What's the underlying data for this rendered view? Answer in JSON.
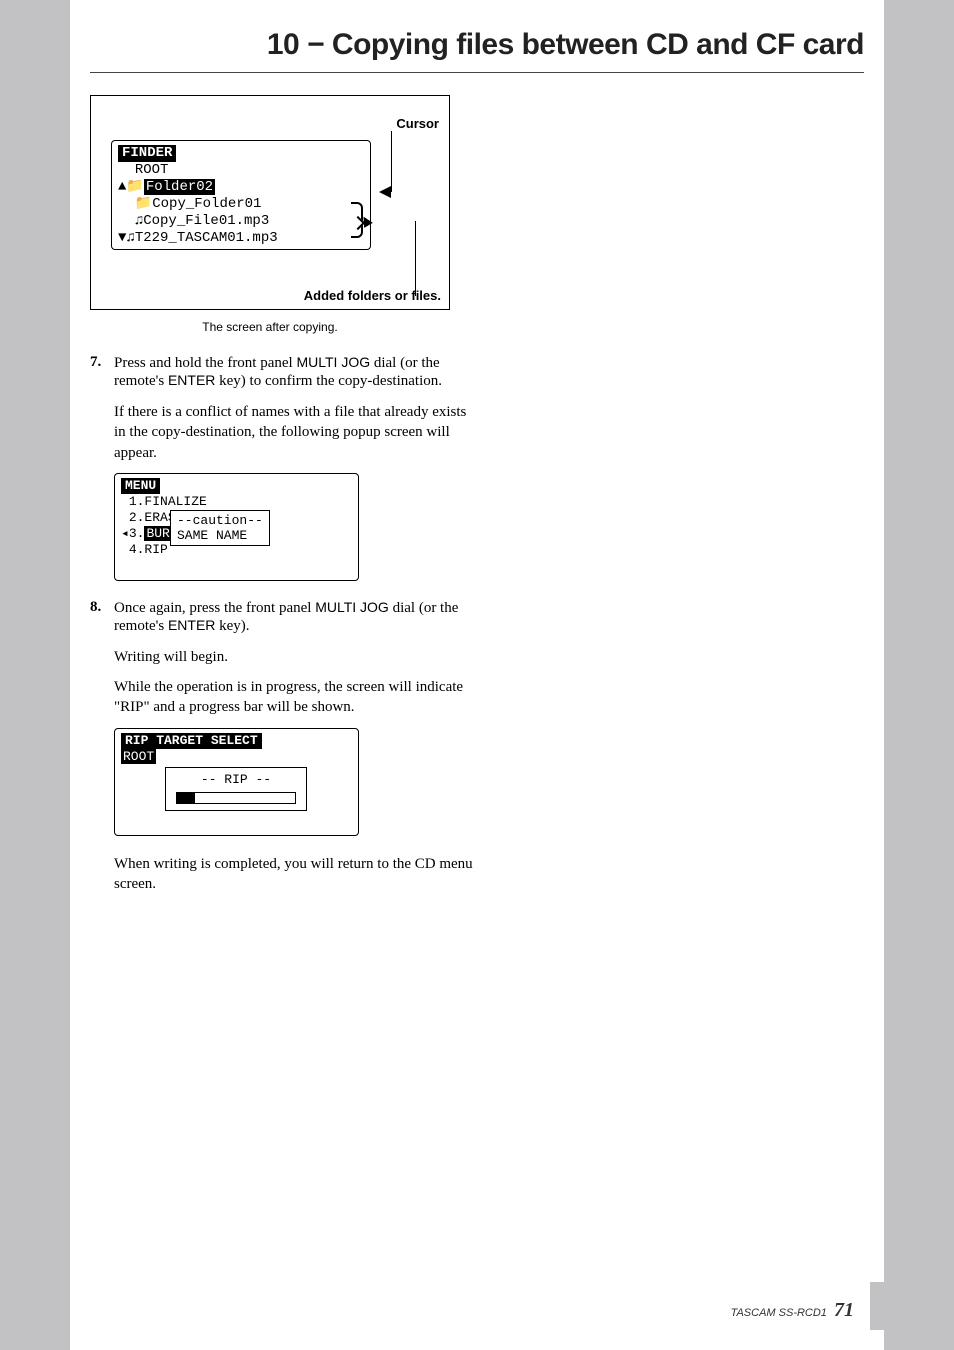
{
  "chapter_title": "10 − Copying files between CD and CF card",
  "figure1": {
    "cursor_label": "Cursor",
    "added_label": "Added folders or files.",
    "caption": "The screen after copying.",
    "lcd": {
      "header": "FINDER",
      "root": "ROOT",
      "selected": "Folder02",
      "line3": "Copy_Folder01",
      "line4": "Copy_File01.mp3",
      "line5": "T229_TASCAM01.mp3"
    }
  },
  "step7": {
    "num": "7.",
    "pre": "Press and hold the front panel ",
    "dial": "MULTI JOG",
    "mid": " dial (or the remote's ",
    "enter": "ENTER",
    "post": " key) to confirm the copy-destination.",
    "para": "If there is a conflict of names with a file that already exists in the copy-destination, the following popup screen will appear."
  },
  "lcd_menu": {
    "header": "MENU",
    "l1": "1.FINALIZE",
    "l2": "2.ERAS",
    "l3a": "3.",
    "l3b": "BURN",
    "l4": "4.RIP",
    "popup_l1": "--caution--",
    "popup_l2": "SAME NAME"
  },
  "step8": {
    "num": "8.",
    "pre": "Once again, press the front panel ",
    "dial": "MULTI JOG",
    "mid": " dial (or the remote's ",
    "enter": "ENTER",
    "post": " key).",
    "para1": "Writing will begin.",
    "para2": "While the operation is in progress, the screen will indicate \"RIP\" and a progress bar will be shown."
  },
  "lcd_rip": {
    "title": "RIP TARGET SELECT",
    "root": "ROOT",
    "popup": "-- RIP --"
  },
  "step8_after": "When writing is completed, you will return to the CD menu screen.",
  "footer": {
    "model": "TASCAM  SS-RCD1",
    "page": "71"
  }
}
